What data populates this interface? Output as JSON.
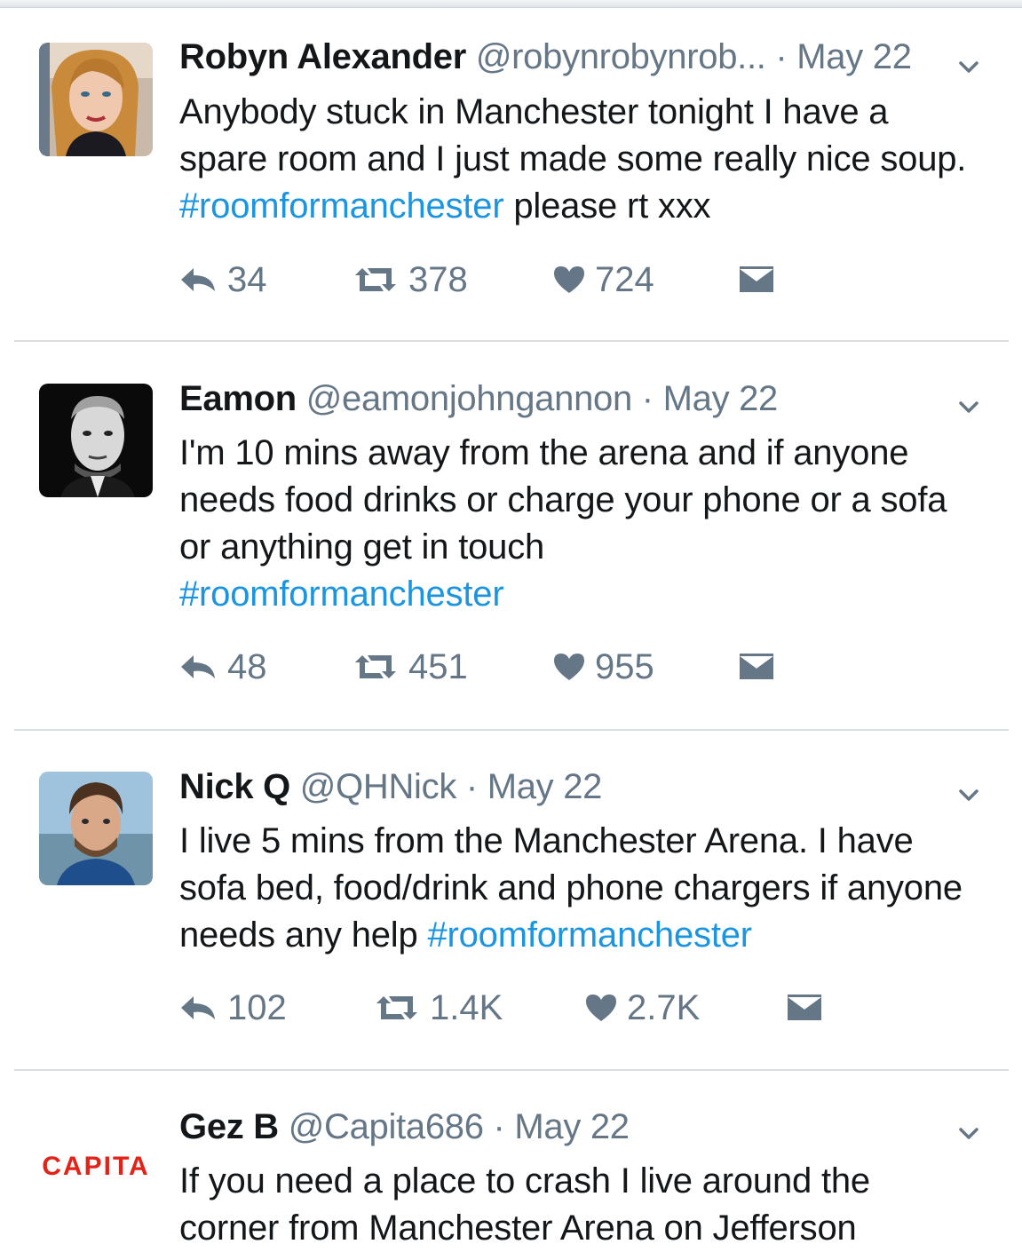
{
  "tweets": [
    {
      "name": "Robyn Alexander",
      "handle": "@robynrobynrob...",
      "dot": "·",
      "date": "May 22",
      "text_1": "Anybody stuck in Manchester tonight I have a spare room and I just made some really nice soup. ",
      "hashtag": "#roomformanchester",
      "text_2": " please rt xxx",
      "replies": "34",
      "retweets": "378",
      "likes": "724"
    },
    {
      "name": "Eamon",
      "handle": "@eamonjohngannon",
      "dot": "·",
      "date": "May 22",
      "text_1": "I'm 10 mins away from the arena and if anyone needs food drinks or  charge your phone or a sofa or anything get in touch",
      "hashtag": "#roomformanchester",
      "text_2": "",
      "replies": "48",
      "retweets": "451",
      "likes": "955"
    },
    {
      "name": "Nick Q",
      "handle": "@QHNick",
      "dot": "·",
      "date": "May 22",
      "text_1": "I live 5 mins from the Manchester Arena. I have sofa bed, food/drink and phone chargers if anyone needs any help ",
      "hashtag": "#roomformanchester",
      "text_2": "",
      "replies": "102",
      "retweets": "1.4K",
      "likes": "2.7K"
    },
    {
      "name": "Gez B",
      "handle": "@Capita686",
      "dot": "·",
      "date": "May 22",
      "text_1": "If you need a place to crash I live around the corner from Manchester Arena on Jefferson",
      "avatar_logo": "CAPITA"
    }
  ],
  "icons": {
    "reply": "reply-icon",
    "retweet": "retweet-icon",
    "like": "heart-icon",
    "message": "envelope-icon",
    "caret": "chevron-down-icon"
  },
  "colors": {
    "hashtag": "#1b95e0",
    "secondary_text": "#657786",
    "icon": "#657786",
    "divider": "#d9dee2",
    "capita_red": "#e2231a"
  }
}
